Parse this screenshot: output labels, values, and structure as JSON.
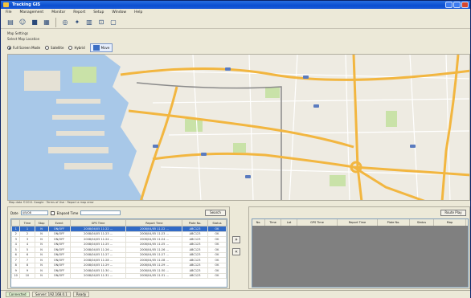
{
  "window": {
    "title": "Tracking GIS",
    "accent": "#0b4fd0"
  },
  "menu": [
    "File",
    "Management",
    "Monitor",
    "Report",
    "Setup",
    "Window",
    "Help"
  ],
  "toolbar": {
    "icons": [
      "new-icon",
      "person-icon",
      "truck-icon",
      "grid-icon",
      "binoculars-icon",
      "pin-icon",
      "chart-icon",
      "vehicle-icon",
      "window-icon"
    ]
  },
  "mapbar": {
    "caption": "Map Settings",
    "path": "Select Map Location",
    "radios": [
      {
        "label": "Full Screen Mode",
        "checked": true
      },
      {
        "label": "Satellite",
        "checked": false
      },
      {
        "label": "Hybrid",
        "checked": false
      }
    ],
    "view_label": "Move"
  },
  "map": {
    "status": "Map data ©2011 Google · Terms of Use · Report a map error",
    "colors": {
      "land": "#eeebe2",
      "water": "#a8c8e8",
      "road": "#f2b640",
      "minor": "#ffffff",
      "park": "#c9e2a8"
    }
  },
  "left": {
    "filter": {
      "label": "Date",
      "value": "4/5/08",
      "check_label": "Elapsed Time",
      "check_value": "",
      "search": "Search"
    },
    "columns": [
      "",
      "Time",
      "Stop",
      "Event",
      "GPS Time",
      "Report Time",
      "Plate No.",
      "Status"
    ],
    "rows": [
      [
        "1",
        "1",
        "N",
        "ON/OFF",
        "2008/04/05 11:22 ...",
        "2008/04/05 11:22 ...",
        "ABC123",
        "OK"
      ],
      [
        "2",
        "2",
        "N",
        "ON/OFF",
        "2008/04/05 11:23 ...",
        "2008/04/05 11:23 ...",
        "ABC123",
        "OK"
      ],
      [
        "3",
        "3",
        "N",
        "ON/OFF",
        "2008/04/05 11:24 ...",
        "2008/04/05 11:24 ...",
        "ABC123",
        "OK"
      ],
      [
        "4",
        "4",
        "N",
        "ON/OFF",
        "2008/04/05 11:25 ...",
        "2008/04/05 11:25 ...",
        "ABC123",
        "OK"
      ],
      [
        "5",
        "5",
        "N",
        "ON/OFF",
        "2008/04/05 11:26 ...",
        "2008/04/05 11:26 ...",
        "ABC123",
        "OK"
      ],
      [
        "6",
        "6",
        "N",
        "ON/OFF",
        "2008/04/05 11:27 ...",
        "2008/04/05 11:27 ...",
        "ABC123",
        "OK"
      ],
      [
        "7",
        "7",
        "N",
        "ON/OFF",
        "2008/04/05 11:28 ...",
        "2008/04/05 11:28 ...",
        "ABC123",
        "OK"
      ],
      [
        "8",
        "8",
        "N",
        "ON/OFF",
        "2008/04/05 11:29 ...",
        "2008/04/05 11:29 ...",
        "ABC123",
        "OK"
      ],
      [
        "9",
        "9",
        "N",
        "ON/OFF",
        "2008/04/05 11:30 ...",
        "2008/04/05 11:30 ...",
        "ABC123",
        "OK"
      ],
      [
        "10",
        "10",
        "N",
        "ON/OFF",
        "2008/04/05 11:31 ...",
        "2008/04/05 11:31 ...",
        "ABC123",
        "OK"
      ]
    ],
    "selected_index": 0
  },
  "arrows": {
    "add": "»",
    "remove": "«"
  },
  "right": {
    "top_button": "Route Play",
    "columns": [
      "No.",
      "Time",
      "Lat",
      "GPS Time",
      "Report Time",
      "Plate No.",
      "Status",
      "Map"
    ]
  },
  "status": {
    "left": "Connected",
    "middle": "Server: 192.168.0.1",
    "right": "Ready"
  }
}
